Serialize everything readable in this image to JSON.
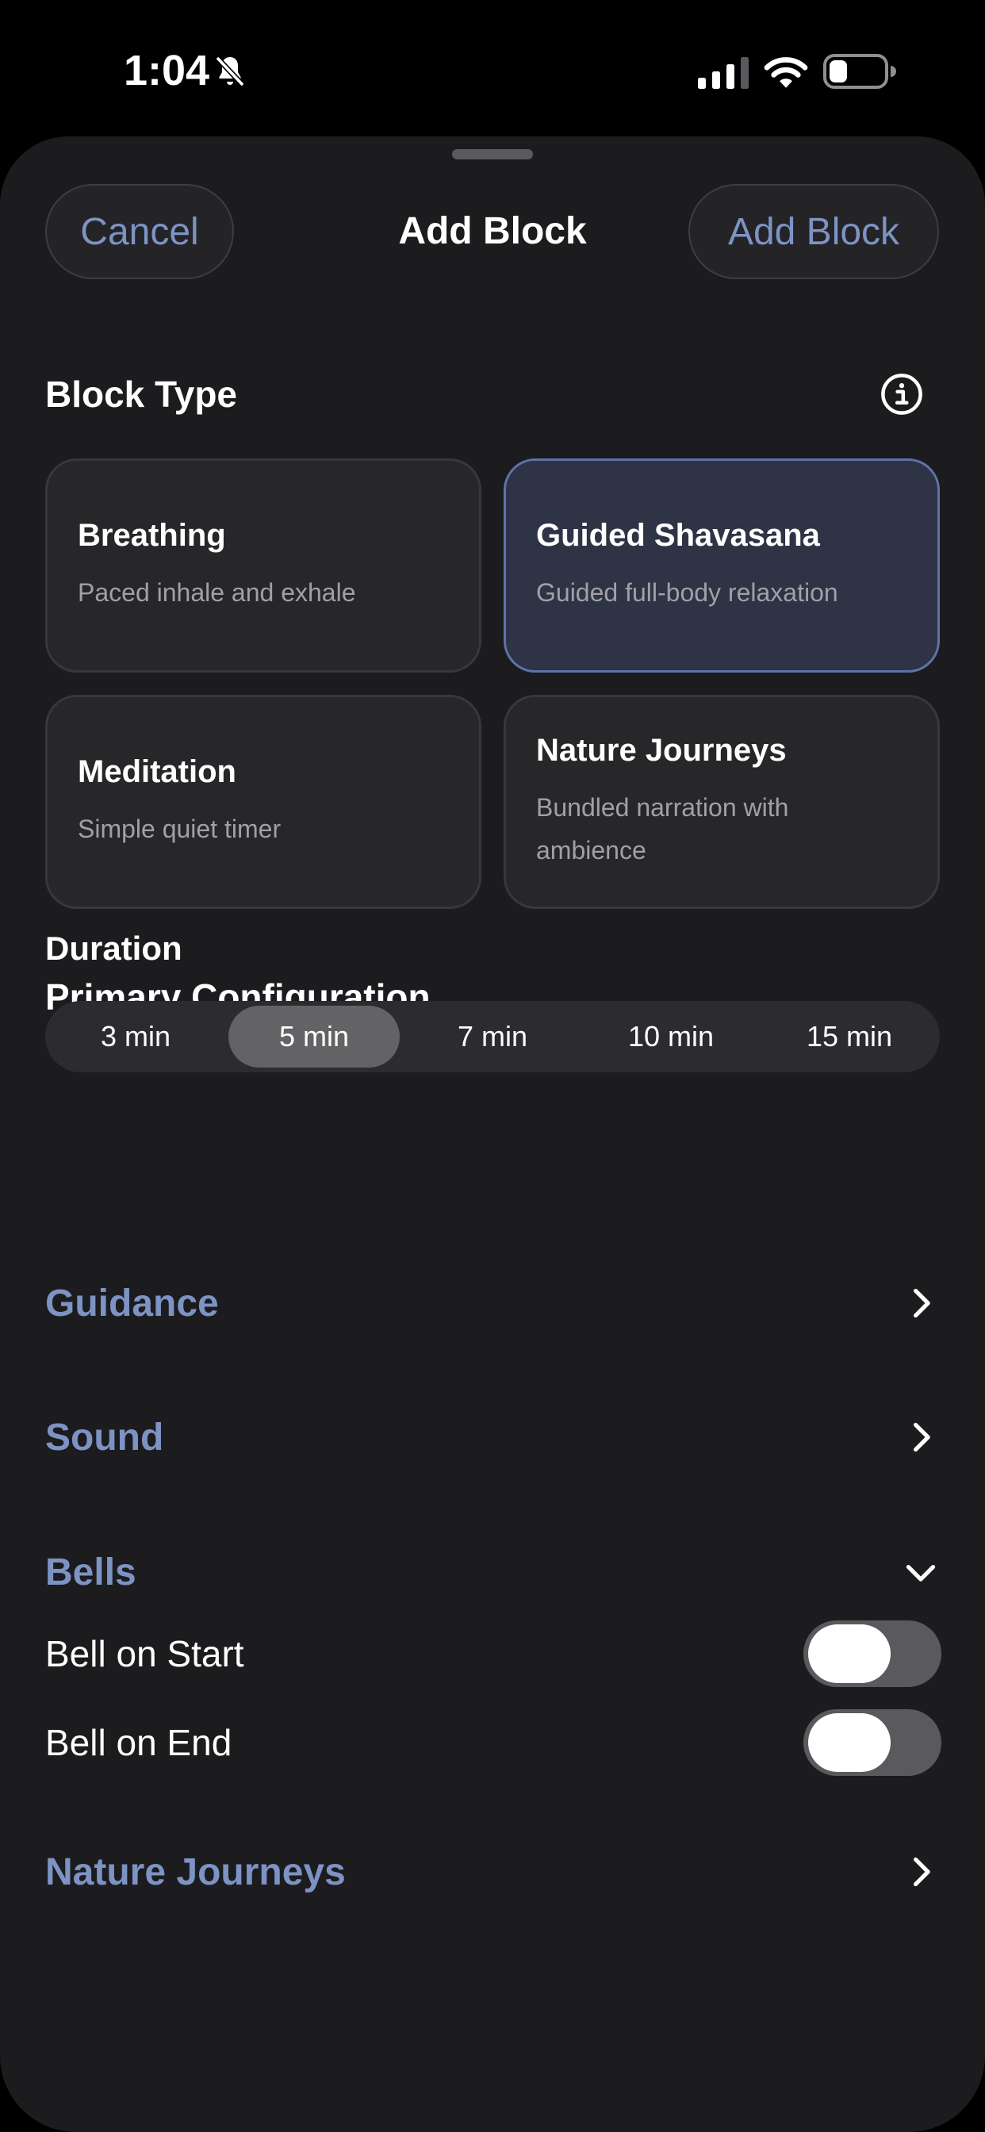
{
  "status_bar": {
    "time": "1:04",
    "icons": [
      "bell-slash-icon",
      "cellular-signal-icon",
      "wifi-icon",
      "battery-icon"
    ]
  },
  "nav": {
    "cancel_label": "Cancel",
    "title": "Add Block",
    "add_label": "Add Block"
  },
  "block_type": {
    "heading": "Block Type",
    "info_icon": "info-icon",
    "cards": [
      {
        "title": "Breathing",
        "subtitle": "Paced inhale and exhale",
        "selected": false
      },
      {
        "title": "Guided Shavasana",
        "subtitle": "Guided full-body relaxation",
        "selected": true
      },
      {
        "title": "Meditation",
        "subtitle": "Simple quiet timer",
        "selected": false
      },
      {
        "title": "Nature Journeys",
        "subtitle": "Bundled narration with ambience",
        "selected": false
      }
    ]
  },
  "primary_config": {
    "heading": "Primary Configuration",
    "duration_label": "Duration",
    "duration_options": [
      "3 min",
      "5 min",
      "7 min",
      "10 min",
      "15 min"
    ],
    "selected_duration": "5 min"
  },
  "sections": {
    "guidance": "Guidance",
    "sound": "Sound",
    "bells": "Bells",
    "nature_journeys": "Nature Journeys"
  },
  "bells": {
    "bell_on_start_label": "Bell on Start",
    "bell_on_start_enabled": false,
    "bell_on_end_label": "Bell on End",
    "bell_on_end_enabled": false
  },
  "colors": {
    "accent": "#7d93c4",
    "sheet_background": "#1c1c1e",
    "selected_card": "#2e3345"
  }
}
